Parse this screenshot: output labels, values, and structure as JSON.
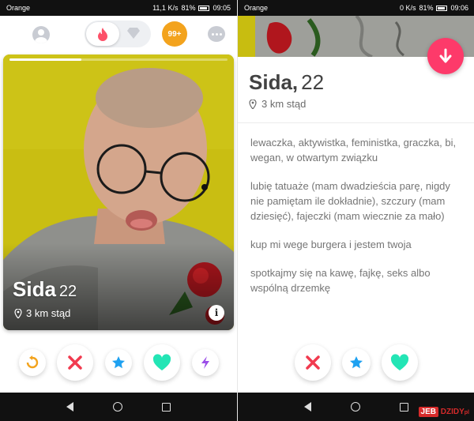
{
  "left": {
    "status": {
      "carrier": "Orange",
      "speed": "11,1 K/s",
      "battery": "81%",
      "time": "09:05"
    },
    "nav": {
      "badge": "99+"
    },
    "card": {
      "name": "Sida",
      "age": "22",
      "distance": "3 km stąd",
      "info": "i",
      "photo_progress": 0.33
    },
    "actions": [
      "rewind",
      "nope",
      "super-like",
      "like",
      "boost"
    ]
  },
  "right": {
    "status": {
      "carrier": "Orange",
      "speed": "0 K/s",
      "battery": "81%",
      "time": "09:06"
    },
    "profile": {
      "name": "Sida,",
      "age": "22",
      "distance": "3 km stąd"
    },
    "bio": [
      "lewaczka, aktywistka, feministka, graczka, bi, wegan, w otwartym związku",
      "lubię tatuaże (mam dwadzieścia parę, nigdy nie pamiętam ile dokładnie), szczury (mam dziesięć), fajeczki (mam wiecznie za mało)",
      "kup mi wege burgera i jestem twoja",
      "spotkajmy się na kawę, fajkę, seks albo wspólną drzemkę"
    ],
    "watermark": {
      "box": "JEB",
      "text": "DZIDY",
      "suffix": "pl"
    }
  },
  "colors": {
    "tinder_pink": "#fd3a6a",
    "like_green": "#23e5b5",
    "nope_red": "#f13a4f",
    "star_blue": "#1ea1f1",
    "gold": "#f3a31d",
    "boost_purple": "#9b4ee8"
  }
}
